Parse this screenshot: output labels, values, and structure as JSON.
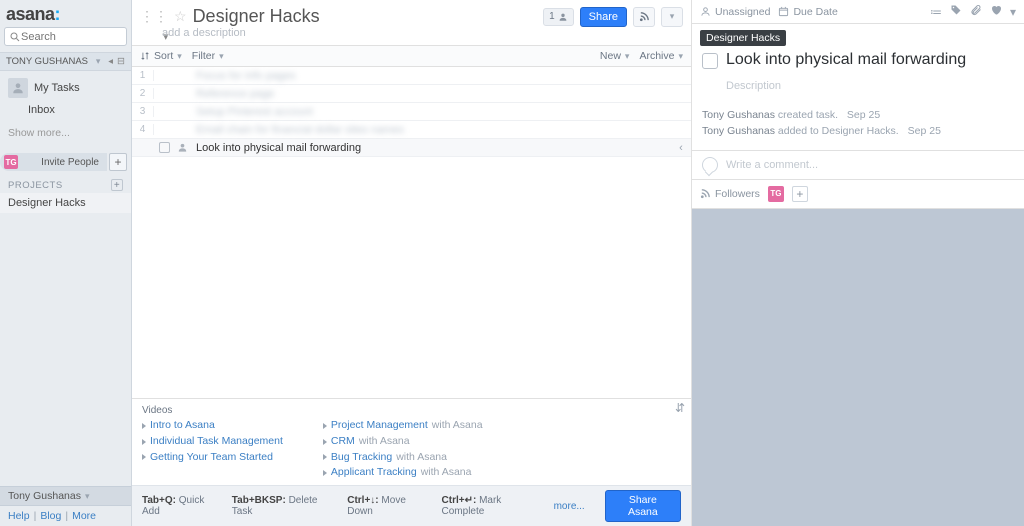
{
  "brand": {
    "name": "asana"
  },
  "sidebar": {
    "search_placeholder": "Search",
    "user_menu": "TONY GUSHANAS",
    "items": {
      "my_tasks": "My Tasks",
      "inbox": "Inbox"
    },
    "show_more": "Show more...",
    "invite_label": "Invite People",
    "avatar_initials": "TG",
    "projects_header": "PROJECTS",
    "projects": [
      {
        "name": "Designer Hacks"
      }
    ],
    "footer_user": "Tony Gushanas",
    "footer_links": {
      "help": "Help",
      "blog": "Blog",
      "more": "More"
    }
  },
  "center": {
    "project_title": "Designer Hacks",
    "project_desc_placeholder": "add a description",
    "member_count": "1",
    "share_label": "Share",
    "toolbar": {
      "sort": "Sort",
      "filter": "Filter",
      "new": "New",
      "archive": "Archive"
    },
    "tasks": [
      {
        "n": "1",
        "text": "Focus for info pages",
        "blur": true
      },
      {
        "n": "2",
        "text": "Reference page",
        "blur": true
      },
      {
        "n": "3",
        "text": "Setup Pinterest account",
        "blur": true
      },
      {
        "n": "4",
        "text": "Email chain for financial dollar sites names",
        "blur": true
      },
      {
        "n": "",
        "text": "Look into physical mail forwarding",
        "blur": false,
        "selected": true
      }
    ],
    "help": {
      "videos_header": "Videos",
      "col1": [
        {
          "label": "Intro to Asana"
        },
        {
          "label": "Individual Task Management"
        },
        {
          "label": "Getting Your Team Started"
        }
      ],
      "col2": [
        {
          "label": "Project Management",
          "suffix": "with Asana"
        },
        {
          "label": "CRM",
          "suffix": "with Asana"
        },
        {
          "label": "Bug Tracking",
          "suffix": "with Asana"
        },
        {
          "label": "Applicant Tracking",
          "suffix": "with Asana"
        }
      ]
    },
    "shortcuts": {
      "s1_key": "Tab+Q:",
      "s1_lbl": "Quick Add",
      "s2_key": "Tab+BKSP:",
      "s2_lbl": "Delete Task",
      "s3_key": "Ctrl+↓:",
      "s3_lbl": "Move Down",
      "s4_key": "Ctrl+↵:",
      "s4_lbl": "Mark Complete",
      "more": "more...",
      "share_asana": "Share Asana"
    }
  },
  "detail": {
    "unassigned": "Unassigned",
    "due_date": "Due Date",
    "project_pill": "Designer Hacks",
    "task_title": "Look into physical mail forwarding",
    "desc_placeholder": "Description",
    "activity": [
      {
        "who": "Tony Gushanas",
        "action": "created task.",
        "date": "Sep 25"
      },
      {
        "who": "Tony Gushanas",
        "action": "added to Designer Hacks.",
        "date": "Sep 25"
      }
    ],
    "comment_placeholder": "Write a comment...",
    "followers_label": "Followers",
    "follower_initials": "TG"
  }
}
